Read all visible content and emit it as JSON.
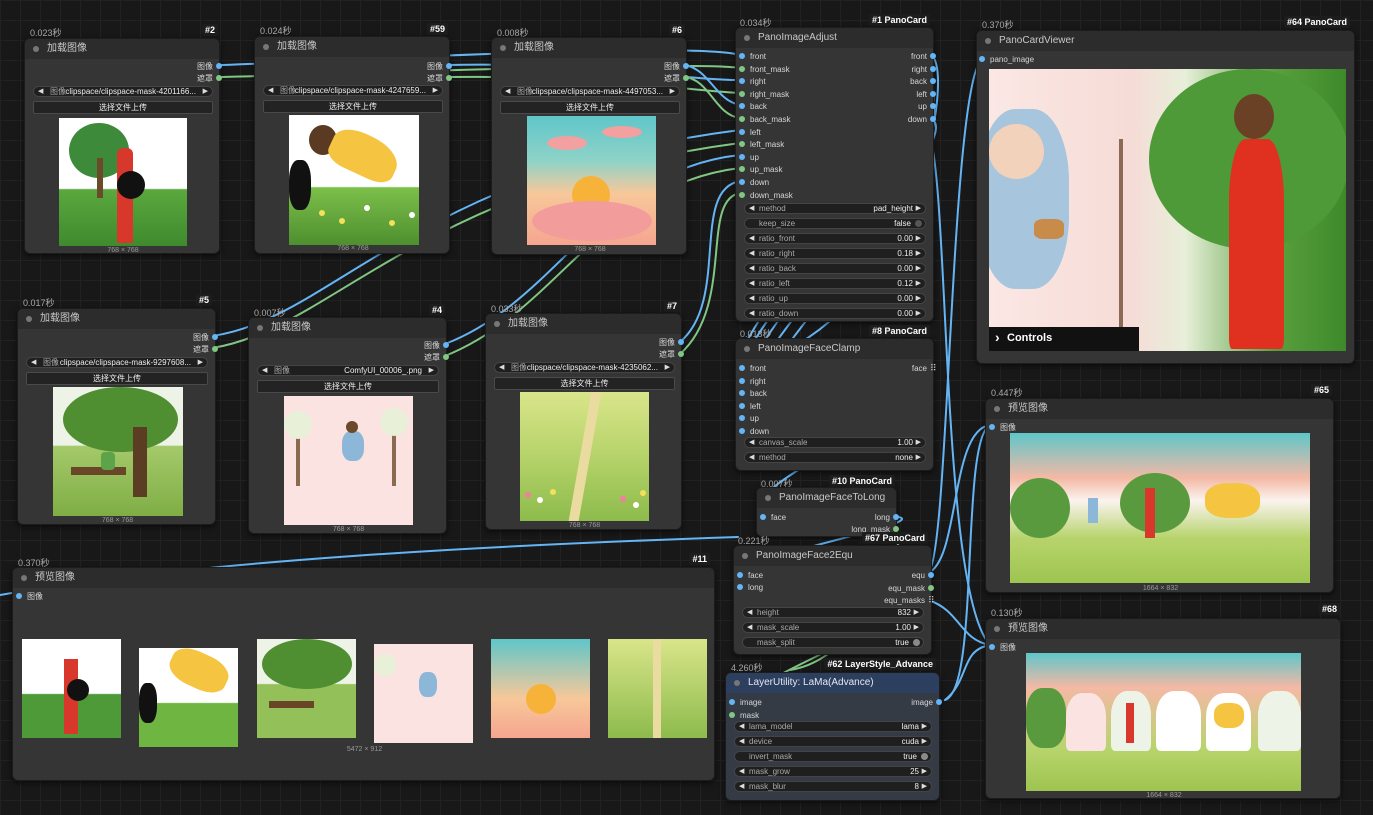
{
  "nodes": {
    "n2": {
      "timing": "0.023秒",
      "tag": "#2",
      "title": "加载图像",
      "out1": "图像",
      "out2": "遮罩",
      "file_label": "图像",
      "file": "clipspace/clipspace-mask-4201166...",
      "upload": "选择文件上传",
      "dims": "768 × 768"
    },
    "n59": {
      "timing": "0.024秒",
      "tag": "#59",
      "title": "加载图像",
      "out1": "图像",
      "out2": "遮罩",
      "file_label": "图像",
      "file": "clipspace/clipspace-mask-4247659...",
      "upload": "选择文件上传",
      "dims": "768 × 768"
    },
    "n6": {
      "timing": "0.008秒",
      "tag": "#6",
      "title": "加载图像",
      "out1": "图像",
      "out2": "遮罩",
      "file_label": "图像",
      "file": "clipspace/clipspace-mask-4497053...",
      "upload": "选择文件上传",
      "dims": "768 × 768"
    },
    "n5": {
      "timing": "0.017秒",
      "tag": "#5",
      "title": "加载图像",
      "out1": "图像",
      "out2": "遮罩",
      "file_label": "图像",
      "file": "clipspace/clipspace-mask-9297608...",
      "upload": "选择文件上传",
      "dims": "768 × 768"
    },
    "n4": {
      "timing": "0.007秒",
      "tag": "#4",
      "title": "加载图像",
      "out1": "图像",
      "out2": "遮罩",
      "file_label": "图像",
      "file": "ComfyUI_00006_.png",
      "upload": "选择文件上传",
      "dims": "768 × 768"
    },
    "n7": {
      "timing": "0.033秒",
      "tag": "#7",
      "title": "加载图像",
      "out1": "图像",
      "out2": "遮罩",
      "file_label": "图像",
      "file": "clipspace/clipspace-mask-4235062...",
      "upload": "选择文件上传",
      "dims": "768 × 768"
    },
    "n1": {
      "timing": "0.034秒",
      "tag": "#1 PanoCard",
      "title": "PanoImageAdjust",
      "inputs": [
        "front",
        "front_mask",
        "right",
        "right_mask",
        "back",
        "back_mask",
        "left",
        "left_mask",
        "up",
        "up_mask",
        "down",
        "down_mask"
      ],
      "outputs": [
        "front",
        "right",
        "back",
        "left",
        "up",
        "down"
      ],
      "widgets": [
        {
          "label": "method",
          "value": "pad_height"
        },
        {
          "label": "keep_size",
          "value": "false"
        },
        {
          "label": "ratio_front",
          "value": "0.00"
        },
        {
          "label": "ratio_right",
          "value": "0.18"
        },
        {
          "label": "ratio_back",
          "value": "0.00"
        },
        {
          "label": "ratio_left",
          "value": "0.12"
        },
        {
          "label": "ratio_up",
          "value": "0.00"
        },
        {
          "label": "ratio_down",
          "value": "0.00"
        }
      ]
    },
    "n64": {
      "timing": "0.370秒",
      "tag": "#64 PanoCard",
      "title": "PanoCardViewer",
      "input": "pano_image",
      "controls": "Controls"
    },
    "n8": {
      "timing": "0.013秒",
      "tag": "#8 PanoCard",
      "title": "PanoImageFaceClamp",
      "inputs": [
        "front",
        "right",
        "back",
        "left",
        "up",
        "down"
      ],
      "output": "face",
      "widgets": [
        {
          "label": "canvas_scale",
          "value": "1.00"
        },
        {
          "label": "method",
          "value": "none"
        }
      ]
    },
    "n10": {
      "timing": "0.007秒",
      "tag": "#10 PanoCard",
      "title": "PanoImageFaceToLong",
      "input": "face",
      "out1": "long",
      "out2": "long_mask"
    },
    "n67": {
      "timing": "0.221秒",
      "tag": "#67 PanoCard",
      "title": "PanoImageFace2Equ",
      "inputs": [
        "face",
        "long"
      ],
      "outputs": [
        "equ",
        "equ_mask",
        "equ_masks"
      ],
      "widgets": [
        {
          "label": "height",
          "value": "832"
        },
        {
          "label": "mask_scale",
          "value": "1.00"
        },
        {
          "label": "mask_split",
          "value": "true"
        }
      ]
    },
    "n62": {
      "timing": "4.260秒",
      "tag": "#62 LayerStyle_Advance",
      "title": "LayerUtility: LaMa(Advance)",
      "inputs": [
        "image",
        "mask"
      ],
      "output": "image",
      "widgets": [
        {
          "label": "lama_model",
          "value": "lama"
        },
        {
          "label": "device",
          "value": "cuda"
        },
        {
          "label": "invert_mask",
          "value": "true"
        },
        {
          "label": "mask_grow",
          "value": "25"
        },
        {
          "label": "mask_blur",
          "value": "8"
        }
      ]
    },
    "n11": {
      "timing": "0.370秒",
      "tag": "#11",
      "title": "预览图像",
      "input": "图像",
      "dims": "5472 × 912"
    },
    "n65": {
      "timing": "0.447秒",
      "tag": "#65",
      "title": "预览图像",
      "input": "图像",
      "dims": "1664 × 832"
    },
    "n68": {
      "timing": "0.130秒",
      "tag": "#68",
      "title": "预览图像",
      "input": "图像",
      "dims": "1664 × 832"
    }
  },
  "colors": {
    "image_port": "#64b5f6",
    "mask_port": "#81c784",
    "canvas": "#181818",
    "node": "#353535",
    "node_blue": "#2d3f5f"
  }
}
